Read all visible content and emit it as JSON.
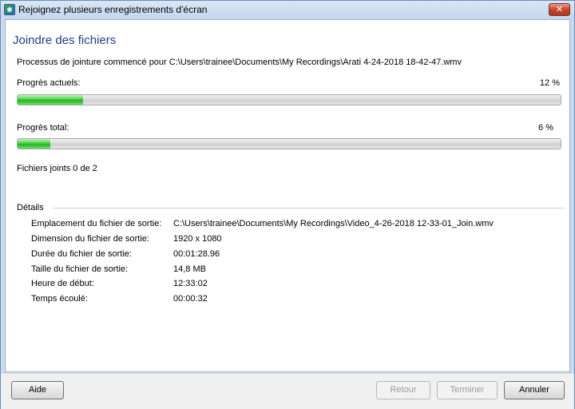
{
  "window": {
    "title": "Rejoignez plusieurs enregistrements d'écran",
    "close_glyph": "✕"
  },
  "page": {
    "title": "Joindre des fichiers",
    "process_text": "Processus de jointure commencé pour C:\\Users\\trainee\\Documents\\My Recordings\\Arati 4-24-2018 18-42-47.wmv"
  },
  "progress": {
    "current_label": "Progrès actuels:",
    "current_pct_text": "12 %",
    "current_value": 12,
    "total_label": "Progrès total:",
    "total_pct_text": "6 %",
    "total_value": 6,
    "files_joined": "Fichiers joints 0 de 2"
  },
  "details": {
    "label": "Détails",
    "rows": [
      {
        "key": "Emplacement du fichier de sortie:",
        "value": "C:\\Users\\trainee\\Documents\\My Recordings\\Video_4-26-2018 12-33-01_Join.wmv"
      },
      {
        "key": "Dimension du fichier de sortie:",
        "value": "1920 x 1080"
      },
      {
        "key": "Durée du fichier de sortie:",
        "value": "00:01:28.96"
      },
      {
        "key": "Taille du fichier de sortie:",
        "value": "14,8 MB"
      },
      {
        "key": "Heure de début:",
        "value": "12:33:02"
      },
      {
        "key": "Temps écoulé:",
        "value": "00:00:32"
      }
    ]
  },
  "footer": {
    "help": "Aide",
    "back": "Retour",
    "finish": "Terminer",
    "cancel": "Annuler"
  }
}
